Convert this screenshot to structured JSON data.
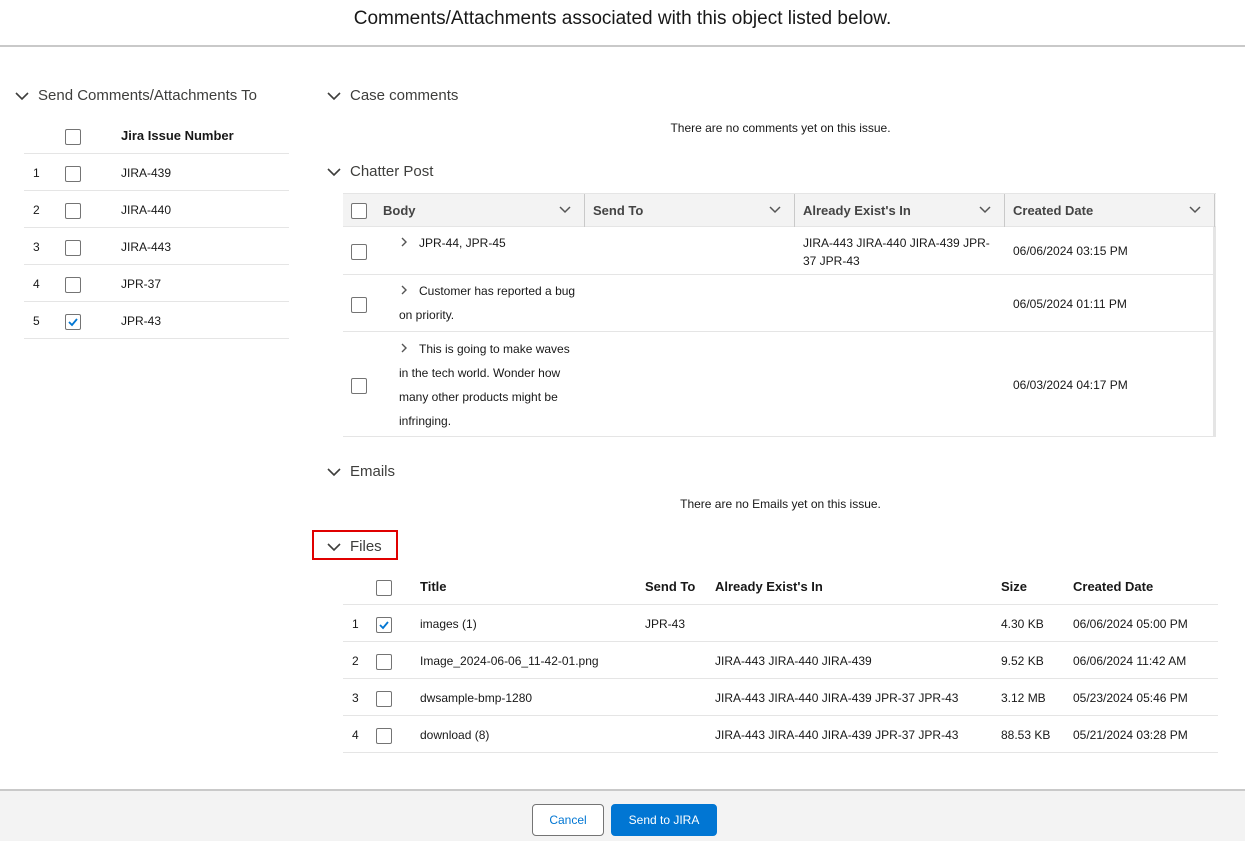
{
  "header": {
    "title": "Comments/Attachments associated with this object listed below."
  },
  "left_panel": {
    "section_title": "Send Comments/Attachments To",
    "column_header": "Jira Issue Number",
    "rows": [
      {
        "num": "1",
        "issue": "JIRA-439",
        "checked": false
      },
      {
        "num": "2",
        "issue": "JIRA-440",
        "checked": false
      },
      {
        "num": "3",
        "issue": "JIRA-443",
        "checked": false
      },
      {
        "num": "4",
        "issue": "JPR-37",
        "checked": false
      },
      {
        "num": "5",
        "issue": "JPR-43",
        "checked": true
      }
    ]
  },
  "case_comments": {
    "section_title": "Case comments",
    "empty_message": "There are no comments yet on this issue."
  },
  "chatter": {
    "section_title": "Chatter Post",
    "columns": [
      "Body",
      "Send To",
      "Already Exist's In",
      "Created Date"
    ],
    "rows": [
      {
        "body": "JPR-44, JPR-45",
        "send_to": "",
        "exist": "JIRA-443 JIRA-440 JIRA-439 JPR-37 JPR-43",
        "date": "06/06/2024 03:15 PM"
      },
      {
        "body": "Customer has reported a bug on priority.",
        "send_to": "",
        "exist": "",
        "date": "06/05/2024 01:11 PM"
      },
      {
        "body": "This is going to make waves in the tech world. Wonder how many other products might be infringing.",
        "send_to": "",
        "exist": "",
        "date": "06/03/2024 04:17 PM"
      }
    ]
  },
  "emails": {
    "section_title": "Emails",
    "empty_message": "There are no Emails yet on this issue."
  },
  "files": {
    "section_title": "Files",
    "columns": [
      "Title",
      "Send To",
      "Already Exist's In",
      "Size",
      "Created Date"
    ],
    "rows": [
      {
        "num": "1",
        "checked": true,
        "title": "images (1)",
        "send_to": "JPR-43",
        "exist": "",
        "size": "4.30 KB",
        "date": "06/06/2024 05:00 PM"
      },
      {
        "num": "2",
        "checked": false,
        "title": "Image_2024-06-06_11-42-01.png",
        "send_to": "",
        "exist": "JIRA-443 JIRA-440 JIRA-439",
        "size": "9.52 KB",
        "date": "06/06/2024 11:42 AM"
      },
      {
        "num": "3",
        "checked": false,
        "title": "dwsample-bmp-1280",
        "send_to": "",
        "exist": "JIRA-443 JIRA-440 JIRA-439 JPR-37 JPR-43",
        "size": "3.12 MB",
        "date": "05/23/2024 05:46 PM"
      },
      {
        "num": "4",
        "checked": false,
        "title": "download (8)",
        "send_to": "",
        "exist": "JIRA-443 JIRA-440 JIRA-439 JPR-37 JPR-43",
        "size": "88.53 KB",
        "date": "05/21/2024 03:28 PM"
      }
    ]
  },
  "footer": {
    "cancel_label": "Cancel",
    "send_label": "Send to JIRA"
  },
  "colors": {
    "brand": "#0176d3",
    "highlight": "#e00000",
    "footer_bg": "#f3f3f3"
  },
  "icons": {
    "section_toggle": "chevron-down-icon",
    "row_expand": "chevron-right-icon",
    "column_menu": "chevron-down-icon",
    "checkbox_mark": "check-icon"
  }
}
